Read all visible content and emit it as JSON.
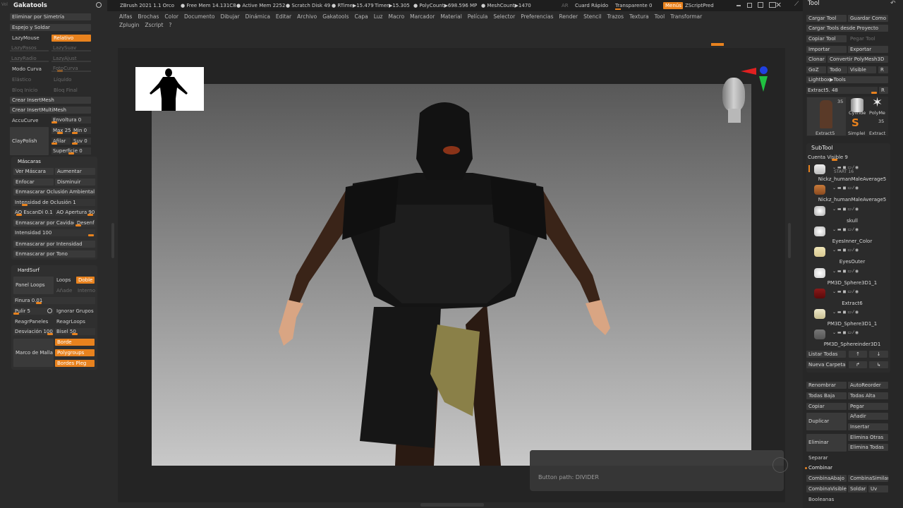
{
  "titlebar": {
    "app_info": "ZBrush 2021 1.1 Orco",
    "free_mem": "● Free Mem 14.131C8",
    "active_mem": "● Active Mem 2252",
    "scratch": "● Scratch Disk 49",
    "rtime": "● RTime▶15.479",
    "timer": "Timer▶15.305",
    "polycount": "● PolyCount▶698.596 MP",
    "meshcount": "● MeshCount▶1470",
    "ar": "AR",
    "quicksave": "Cuard Rápido",
    "transparent": "Transparente 0",
    "menus": "Menús",
    "zscript": "ZScriptPred"
  },
  "main_menu": [
    "Alfas",
    "Brochas",
    "Color",
    "Documento",
    "Dibujar",
    "Dinámica",
    "Editar",
    "Archivo",
    "Gakatools",
    "Capa",
    "Luz",
    "Macro",
    "Marcador",
    "Material",
    "Película",
    "Selector",
    "Preferencias",
    "Render",
    "Stencil",
    "Trazos",
    "Textura",
    "Tool",
    "Transformar"
  ],
  "main_menu_row2": [
    "Zplugin",
    "Zscript",
    "?"
  ],
  "left": {
    "tag": "Vol",
    "title": "Gakatools",
    "eliminar_simetria": "Eliminar por Simetría",
    "espejo": "Espejo y Soldar",
    "lazymouse": "LazyMouse",
    "relativo": "Relativo",
    "lazypasos": "LazyPasos",
    "lazysuav": "LazySuav",
    "lazyradio": "LazyRadio",
    "lazyajust": "LazyAjust",
    "modo_curva": "Modo Curva",
    "fotocurva": "FotoCurva",
    "elastico": "Elástico",
    "liquido": "Líquido",
    "bloq_inicio": "Bloq Inicio",
    "bloq_final": "Bloq Final",
    "crear_insertmesh": "Crear InsertMesh",
    "crear_insertmultimesh": "Crear InsertMultiMesh",
    "accucurve": "AccuCurve",
    "envoltura": "Envoltura 0",
    "claypolish": "ClayPolish",
    "max": "Max 25",
    "min": "Min 0",
    "afilar": "Afilar",
    "suv": "Suv 0",
    "superficie": "Superficie 0",
    "mascaras_title": "Máscaras",
    "ver_mascara": "Ver Máscara",
    "aumentar": "Aumentar",
    "enfocar": "Enfocar",
    "disminuir": "Disminuir",
    "enm_oclusion": "Enmascarar Oclusión Ambiental",
    "intensidad_oclusion": "Intensidad de Oclusión 1",
    "ao_escan": "AO EscanDi 0.1",
    "ao_apertura": "AO Apertura 90",
    "enm_cavidad": "Enmascarar por Cavidad",
    "desenf": "Desenf",
    "intensidad": "Intensidad 100",
    "enm_intensidad": "Enmascarar por Intensidad",
    "enm_tono": "Enmascarar por Tono",
    "hardsurf_title": "HardSurf",
    "panel_loops": "Panel Loops",
    "loops": "Loops",
    "doble": "Doble",
    "anade": "Añade",
    "interno": "Interno",
    "finura": "Finura 0.01",
    "pulir": "Pulir 5",
    "ignorar_grupos": "Ignorar Grupos",
    "reagr_paneles": "ReagrPaneles",
    "reagr_loops": "ReagrLoops",
    "desviacion": "Desviación 100",
    "bisel": "Bisel 50",
    "marco_malla": "Marco de Malla",
    "borde": "Borde",
    "polygroups": "Polygroups",
    "bordes_pleg": "Bordes Pleg"
  },
  "right": {
    "title": "Tool",
    "cargar_tool": "Cargar Tool",
    "guardar_como": "Guardar Como",
    "cargar_proyecto": "Cargar Tools desde Proyecto",
    "copiar_tool": "Copiar Tool",
    "pegar_tool": "Pegar Tool",
    "importar": "Importar",
    "exportar": "Exportar",
    "clonar": "Clonar",
    "convertir": "Convertir PolyMesh3D",
    "goz": "GoZ",
    "todo": "Todo",
    "visible": "Visible",
    "r": "R",
    "lightbox": "Lightbox▶Tools",
    "extract_slider": "Extract5. 48",
    "thumb_count": "35",
    "thumb_cylinder": "Cylinde",
    "thumb_polyme": "PolyMe",
    "thumb_extract": "Extract5",
    "thumb_simple": "SimpleI",
    "thumb_extract2": "Extract",
    "thumb_count2": "35",
    "subtool_title": "SubTool",
    "cuenta_visible": "Cuenta Visible 9",
    "subtools": [
      {
        "name": "Nickz_humanMaleAverage5",
        "extra": "START 16"
      },
      {
        "name": "Nickz_humanMaleAverage5",
        "extra": ""
      },
      {
        "name": "skull",
        "extra": ""
      },
      {
        "name": "EyesInner_Color",
        "extra": ""
      },
      {
        "name": "EyesOuter",
        "extra": ""
      },
      {
        "name": "PM3D_Sphere3D1_1",
        "extra": ""
      },
      {
        "name": "Extract6",
        "extra": ""
      },
      {
        "name": "PM3D_Sphere3D1_1",
        "extra": ""
      },
      {
        "name": "PM3D_Sphereinder3D1",
        "extra": ""
      }
    ],
    "listar_todas": "Listar Todas",
    "nueva_carpeta": "Nueva Carpeta",
    "renombrar": "Renombrar",
    "autoreorder": "AutoReorder",
    "todas_baja": "Todas Baja",
    "todas_alta": "Todas Alta",
    "copiar": "Copiar",
    "pegar": "Pegar",
    "anadir": "Añadir",
    "duplicar": "Duplicar",
    "insertar": "Insertar",
    "elimina_otras": "Elimina Otras",
    "eliminar": "Eliminar",
    "elimina_todas": "Elimina Todas",
    "separar": "Separar",
    "combinar": "Combinar",
    "combina_abajo": "CombinaAbajo",
    "combina_similar": "CombinaSimilar",
    "combina_visible": "CombinaVisible",
    "soldar": "Soldar",
    "uv": "Uv",
    "booleanas": "Booleanas"
  },
  "canvas": {
    "button_path": "Button path: DIVIDER"
  },
  "colors": {
    "accent": "#e8821e",
    "bg": "#2a2a2a",
    "canvas_top": "#5a5a5a",
    "canvas_bottom": "#c4c4c4"
  }
}
